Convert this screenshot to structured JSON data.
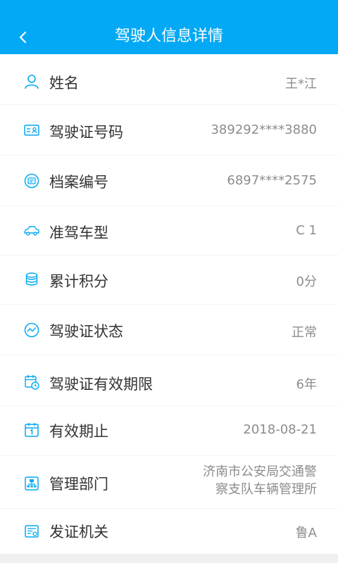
{
  "header": {
    "title": "驾驶人信息详情",
    "back_icon": "chevron-left-icon"
  },
  "colors": {
    "accent": "#03a9f4",
    "label": "#333333",
    "value": "#8c8c8c"
  },
  "rows": [
    {
      "icon": "person-icon",
      "label": "姓名",
      "value": "王*江"
    },
    {
      "icon": "id-card-icon",
      "label": "驾驶证号码",
      "value": "389292****3880"
    },
    {
      "icon": "archive-icon",
      "label": "档案编号",
      "value": "6897****2575"
    },
    {
      "icon": "car-icon",
      "label": "准驾车型",
      "value": "C 1"
    },
    {
      "icon": "coin-stack-icon",
      "label": "累计积分",
      "value": "0分"
    },
    {
      "icon": "trend-icon",
      "label": "驾驶证状态",
      "value": "正常"
    },
    {
      "icon": "calendar-clock-icon",
      "label": "驾驶证有效期限",
      "value": "6年"
    },
    {
      "icon": "calendar-icon",
      "label": "有效期止",
      "value": "2018-08-21"
    },
    {
      "icon": "department-icon",
      "label": "管理部门",
      "value_lines": [
        "济南市公安局交通警",
        "察支队车辆管理所"
      ]
    },
    {
      "icon": "certificate-icon",
      "label": "发证机关",
      "value": "鲁A"
    }
  ]
}
